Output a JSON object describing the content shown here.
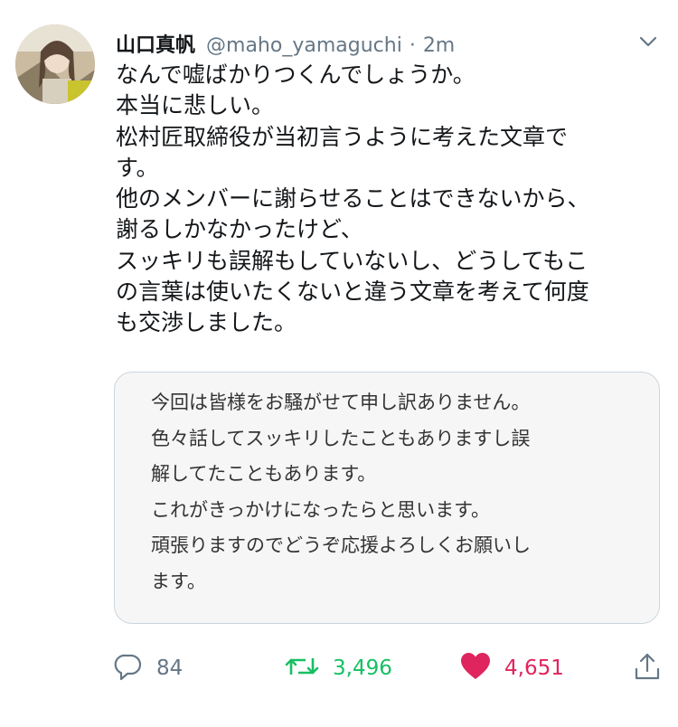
{
  "user": {
    "name": "山口真帆",
    "handle": "@maho_yamaguchi",
    "separator": "·",
    "time": "2m"
  },
  "tweet": {
    "lines": [
      "なんで嘘ばかりつくんでしょうか。",
      "本当に悲しい。",
      "松村匠取締役が当初言うように考えた文章で",
      "す。",
      "他のメンバーに謝らせることはできないから、",
      "謝るしかなかったけど、",
      "スッキリも誤解もしていないし、どうしてもこ",
      "の言葉は使いたくないと違う文章を考えて何度",
      "も交渉しました。"
    ]
  },
  "card": {
    "lines": [
      "今回は皆様をお騒がせて申し訳ありません。",
      "色々話してスッキリしたこともありますし誤",
      "解してたこともあります。",
      "これがきっかけになったらと思います。",
      "頑張りますのでどうぞ応援よろしくお願いし",
      "ます。"
    ]
  },
  "actions": {
    "reply_count": "84",
    "retweet_count": "3,496",
    "like_count": "4,651"
  },
  "icons": {
    "reply": "reply-icon",
    "retweet": "retweet-icon",
    "like": "heart-icon",
    "share": "share-icon",
    "menu": "chevron-down-icon"
  },
  "colors": {
    "retweet": "#17bf63",
    "like": "#e0245e",
    "secondary_text": "#657786"
  }
}
